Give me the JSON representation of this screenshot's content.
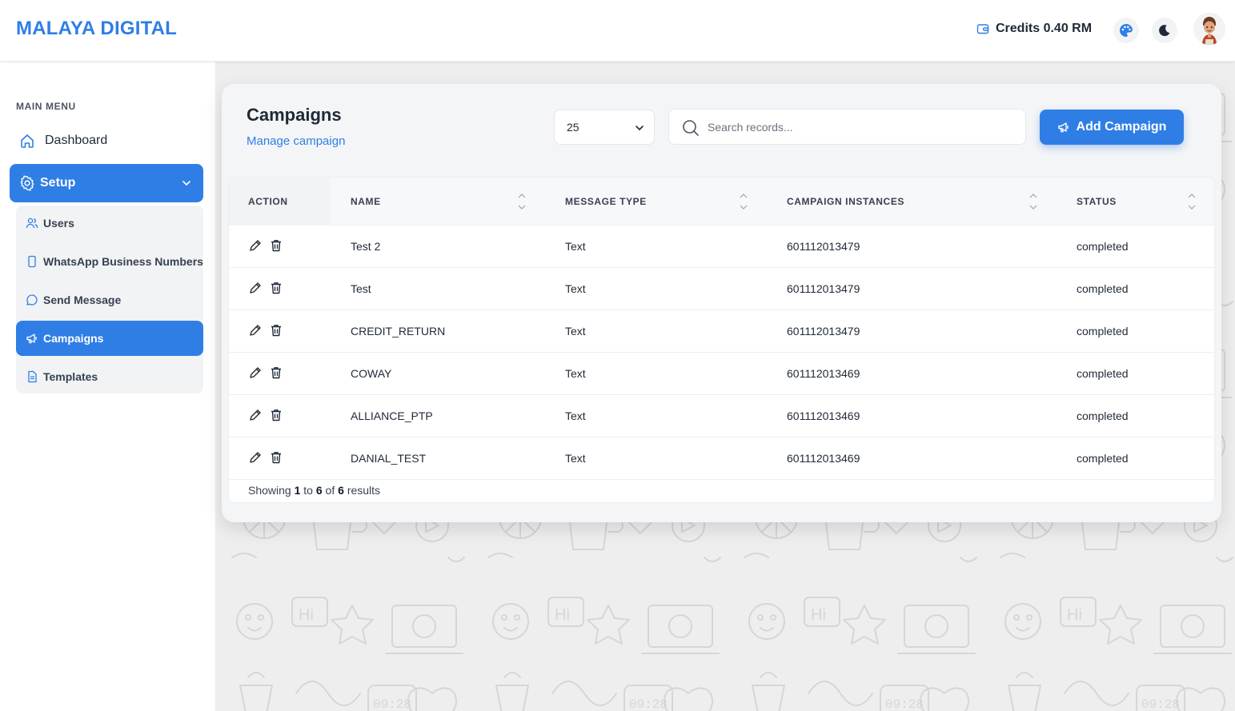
{
  "header": {
    "brand": "MALAYA DIGITAL",
    "credits_label": "Credits 0.40 RM",
    "icons": [
      "wallet-icon",
      "palette-icon",
      "moon-icon",
      "avatar"
    ]
  },
  "sidebar": {
    "section_label": "MAIN MENU",
    "dashboard_label": "Dashboard",
    "setup_label": "Setup",
    "sub_items": [
      {
        "label": "Users",
        "icon": "users-icon"
      },
      {
        "label": "WhatsApp Business Numbers",
        "icon": "phone-icon"
      },
      {
        "label": "Send Message",
        "icon": "chat-bubble-icon"
      },
      {
        "label": "Campaigns",
        "icon": "megaphone-icon",
        "active": true
      },
      {
        "label": "Templates",
        "icon": "document-icon"
      }
    ]
  },
  "page": {
    "title": "Campaigns",
    "subtitle": "Manage campaign",
    "per_page": "25",
    "search_placeholder": "Search records...",
    "add_button": "Add Campaign"
  },
  "table": {
    "columns": [
      "ACTION",
      "NAME",
      "MESSAGE TYPE",
      "CAMPAIGN INSTANCES",
      "STATUS"
    ],
    "rows": [
      {
        "name": "Test 2",
        "type": "Text",
        "instance": "601112013479",
        "status": "completed"
      },
      {
        "name": "Test",
        "type": "Text",
        "instance": "601112013479",
        "status": "completed"
      },
      {
        "name": "CREDIT_RETURN",
        "type": "Text",
        "instance": "601112013479",
        "status": "completed"
      },
      {
        "name": "COWAY",
        "type": "Text",
        "instance": "601112013469",
        "status": "completed"
      },
      {
        "name": "ALLIANCE_PTP",
        "type": "Text",
        "instance": "601112013469",
        "status": "completed"
      },
      {
        "name": "DANIAL_TEST",
        "type": "Text",
        "instance": "601112013469",
        "status": "completed"
      }
    ],
    "footer": {
      "prefix": "Showing",
      "from": "1",
      "to_word": "to",
      "to": "6",
      "of_word": "of",
      "total": "6",
      "suffix": "results"
    }
  },
  "colors": {
    "accent": "#2f7ee6",
    "sidebar_sub_bg": "#f1f3f5",
    "pattern_bg": "#eeeeef"
  }
}
